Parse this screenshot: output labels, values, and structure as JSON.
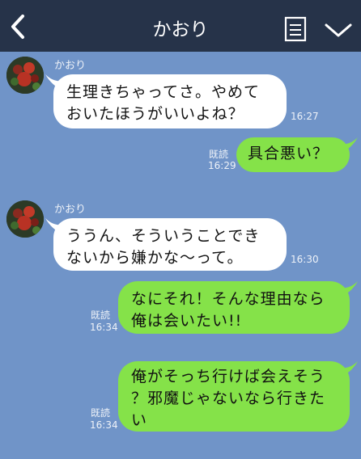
{
  "header": {
    "title": "かおり",
    "back_icon": "chevron-left-icon",
    "notes_icon": "notes-icon",
    "menu_icon": "chevron-down-icon",
    "background": "#263349"
  },
  "colors": {
    "chat_background": "#7094c8",
    "incoming_bubble": "#ffffff",
    "outgoing_bubble": "#85e249"
  },
  "messages": [
    {
      "direction": "in",
      "sender": "かおり",
      "text": "生理きちゃってさ。やめて\nおいたほうがいいよね？",
      "time": "16:27"
    },
    {
      "direction": "out",
      "read_label": "既読",
      "text": "具合悪い？",
      "time": "16:29"
    },
    {
      "direction": "in",
      "sender": "かおり",
      "text": "ううん、そういうことでき\nないから嫌かな〜って。",
      "time": "16:30"
    },
    {
      "direction": "out",
      "read_label": "既読",
      "text": "なにそれ！そんな理由なら\n俺は会いたい!!",
      "time": "16:34"
    },
    {
      "direction": "out",
      "read_label": "既読",
      "text": "俺がそっち行けば会えそう\n？邪魔じゃないなら行きた\nい",
      "time": "16:34"
    }
  ]
}
